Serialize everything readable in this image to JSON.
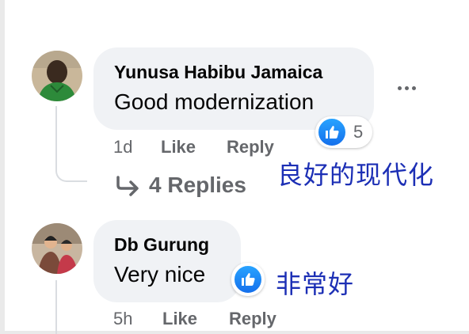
{
  "comments": [
    {
      "author": "Yunusa Habibu Jamaica",
      "text": "Good modernization",
      "time": "1d",
      "like_label": "Like",
      "reply_label": "Reply",
      "reaction_count": "5",
      "replies_label": "4 Replies",
      "annotation": "良好的现代化"
    },
    {
      "author": "Db Gurung",
      "text": "Very nice",
      "time": "5h",
      "like_label": "Like",
      "reply_label": "Reply",
      "annotation": "非常好"
    }
  ],
  "colors": {
    "bubble": "#f0f2f5",
    "meta_text": "#65676b",
    "like_blue": "#1877f2",
    "annotation_ink": "#1c2fb5"
  },
  "icons": [
    "more-options-icon",
    "like-reaction-icon",
    "reply-arrow-icon"
  ]
}
